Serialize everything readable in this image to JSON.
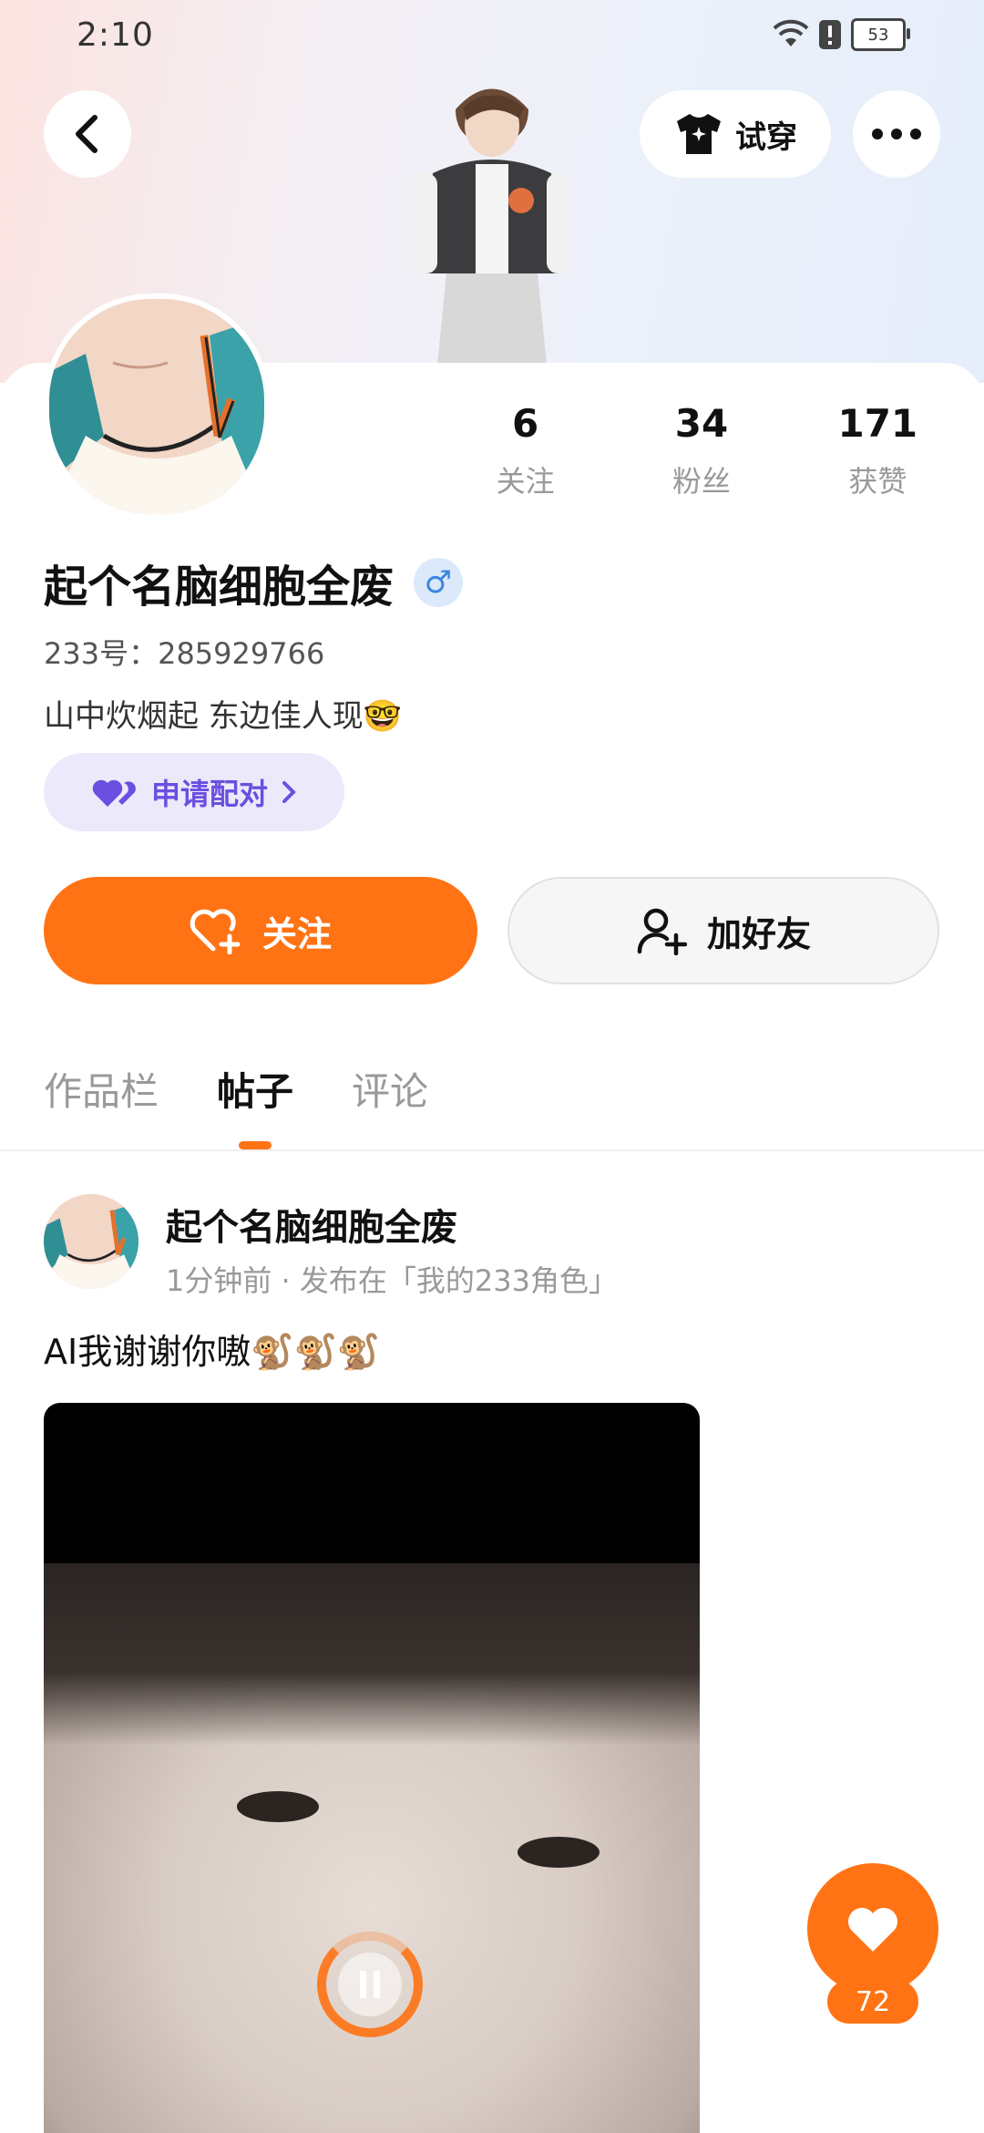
{
  "status_bar": {
    "time": "2:10",
    "battery": "53"
  },
  "header": {
    "try_on_label": "试穿"
  },
  "profile": {
    "stats": [
      {
        "value": "6",
        "label": "关注"
      },
      {
        "value": "34",
        "label": "粉丝"
      },
      {
        "value": "171",
        "label": "获赞"
      }
    ],
    "name": "起个名脑细胞全废",
    "gender_symbol": "♂",
    "uid": "233号：285929766",
    "bio": "山中炊烟起  东边佳人现🤓",
    "pair_label": "申请配对"
  },
  "actions": {
    "follow_label": "关注",
    "add_friend_label": "加好友"
  },
  "tabs": [
    {
      "label": "作品栏",
      "active": false
    },
    {
      "label": "帖子",
      "active": true
    },
    {
      "label": "评论",
      "active": false
    }
  ],
  "post": {
    "author": "起个名脑细胞全废",
    "meta": "1分钟前 · 发布在「我的233角色」",
    "text": "AI我谢谢你嗷🐒🐒🐒"
  },
  "like": {
    "count": "72"
  },
  "colors": {
    "accent": "#ff7314",
    "pair": "#6a4fe0",
    "gender": "#3b86e0"
  }
}
